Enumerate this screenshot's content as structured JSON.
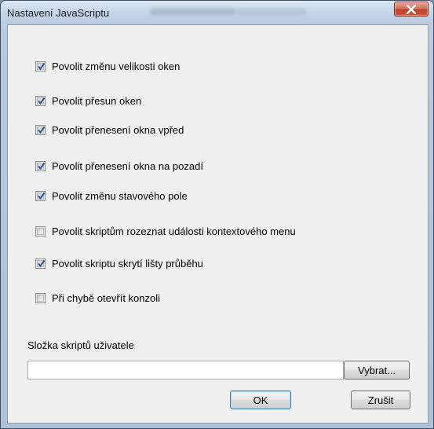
{
  "window": {
    "title": "Nastavení JavaScriptu",
    "close_icon": "close-icon"
  },
  "options": [
    {
      "label": "Povolit změnu velikosti oken",
      "checked": true
    },
    {
      "label": "Povolit přesun oken",
      "checked": true
    },
    {
      "label": "Povolit přenesení okna vpřed",
      "checked": true
    },
    {
      "label": "Povolit přenesení okna na pozadí",
      "checked": true
    },
    {
      "label": "Povolit změnu stavového pole",
      "checked": true
    },
    {
      "label": "Povolit skriptům rozeznat události kontextového menu",
      "checked": false
    },
    {
      "label": "Povolit skriptu skrytí lišty průběhu",
      "checked": true
    },
    {
      "label": "Při chybě otevřít konzoli",
      "checked": false
    }
  ],
  "user_scripts": {
    "label": "Složka skriptů uživatele",
    "value": "",
    "browse_label": "Vybrat..."
  },
  "buttons": {
    "ok_label": "OK",
    "cancel_label": "Zrušit"
  },
  "colors": {
    "check_mark": "#2b4f9e",
    "close_button": "#c7452d"
  }
}
